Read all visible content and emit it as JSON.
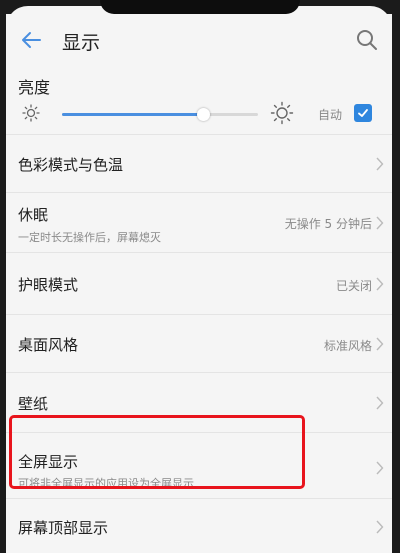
{
  "header": {
    "title": "显示"
  },
  "brightness": {
    "label": "亮度",
    "level_fraction": 0.72,
    "auto_label": "自动",
    "auto_checked": true
  },
  "settings": [
    {
      "title": "色彩模式与色温",
      "subtitle": "",
      "value": ""
    },
    {
      "title": "休眠",
      "subtitle": "一定时长无操作后，屏幕熄灭",
      "value": "无操作 5 分钟后"
    },
    {
      "title": "护眼模式",
      "subtitle": "",
      "value": "已关闭"
    },
    {
      "title": "桌面风格",
      "subtitle": "",
      "value": "标准风格"
    },
    {
      "title": "壁纸",
      "subtitle": "",
      "value": ""
    },
    {
      "title": "全屏显示",
      "subtitle": "可将非全屏显示的应用设为全屏显示",
      "value": ""
    },
    {
      "title": "屏幕顶部显示",
      "subtitle": "",
      "value": ""
    }
  ],
  "colors": {
    "accent": "#2f86de",
    "highlight_box": "#e8141c"
  },
  "icons": {
    "back": "back-arrow-icon",
    "search": "search-icon",
    "brightness_low": "sun-small-icon",
    "brightness_high": "sun-large-icon",
    "chevron": "chevron-right-icon"
  }
}
